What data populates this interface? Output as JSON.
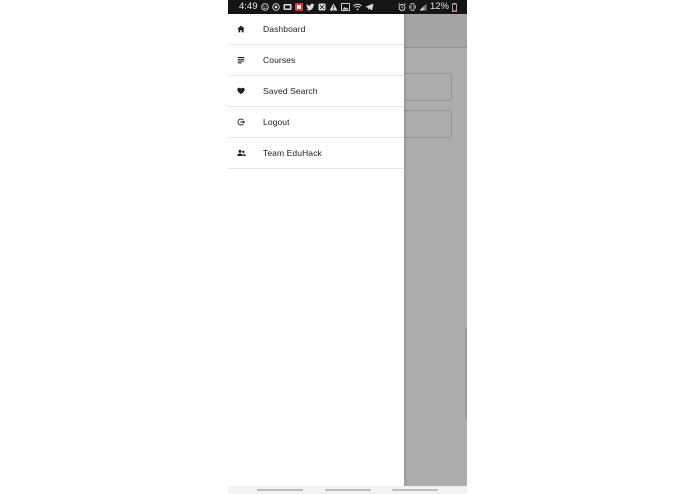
{
  "status_bar": {
    "time": "4:49",
    "battery_text": "12%"
  },
  "drawer": {
    "items": [
      {
        "label": "Dashboard",
        "icon": "home-icon"
      },
      {
        "label": "Courses",
        "icon": "list-icon"
      },
      {
        "label": "Saved Search",
        "icon": "heart-icon"
      },
      {
        "label": "Logout",
        "icon": "logout-icon"
      },
      {
        "label": "Team EduHack",
        "icon": "team-icon"
      }
    ]
  },
  "colors": {
    "status_bar_bg": "#151515",
    "drawer_bg": "#ffffff",
    "scrim": "#000000",
    "text": "#222222",
    "divider": "#e6e6e6"
  }
}
